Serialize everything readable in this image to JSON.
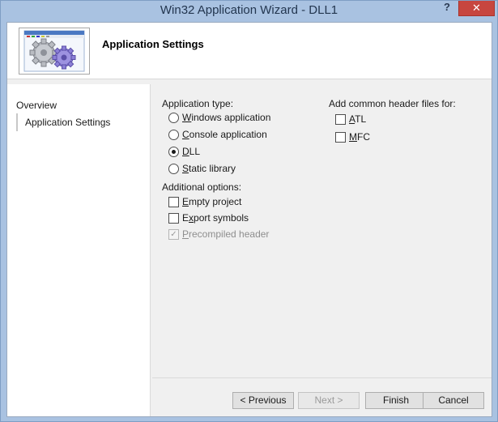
{
  "window": {
    "title": "Win32 Application Wizard - DLL1",
    "help_label": "?",
    "close_label": "✕"
  },
  "header": {
    "title": "Application Settings",
    "image_icon": "gears-icon"
  },
  "sidebar": {
    "items": [
      {
        "label": "Overview",
        "active": false
      },
      {
        "label": "Application Settings",
        "active": true
      }
    ]
  },
  "app_type": {
    "label": "Application type:",
    "options": [
      {
        "accel": "W",
        "rest": "indows application",
        "checked": false
      },
      {
        "accel": "C",
        "rest": "onsole application",
        "checked": false
      },
      {
        "accel": "D",
        "rest": "LL",
        "checked": true
      },
      {
        "accel": "S",
        "rest": "tatic library",
        "checked": false
      }
    ]
  },
  "additional": {
    "label": "Additional options:",
    "options": [
      {
        "accel": "E",
        "rest": "mpty project",
        "checked": false,
        "disabled": false
      },
      {
        "accel": "x",
        "pre": "E",
        "rest": "port symbols",
        "checked": false,
        "disabled": false
      },
      {
        "accel": "P",
        "rest": "recompiled header",
        "checked": true,
        "disabled": true
      }
    ]
  },
  "headers": {
    "label": "Add common header files for:",
    "options": [
      {
        "accel": "A",
        "rest": "TL",
        "checked": false
      },
      {
        "accel": "M",
        "rest": "FC",
        "checked": false
      }
    ]
  },
  "buttons": {
    "previous": "< Previous",
    "next": "Next >",
    "finish": "Finish",
    "cancel": "Cancel"
  }
}
